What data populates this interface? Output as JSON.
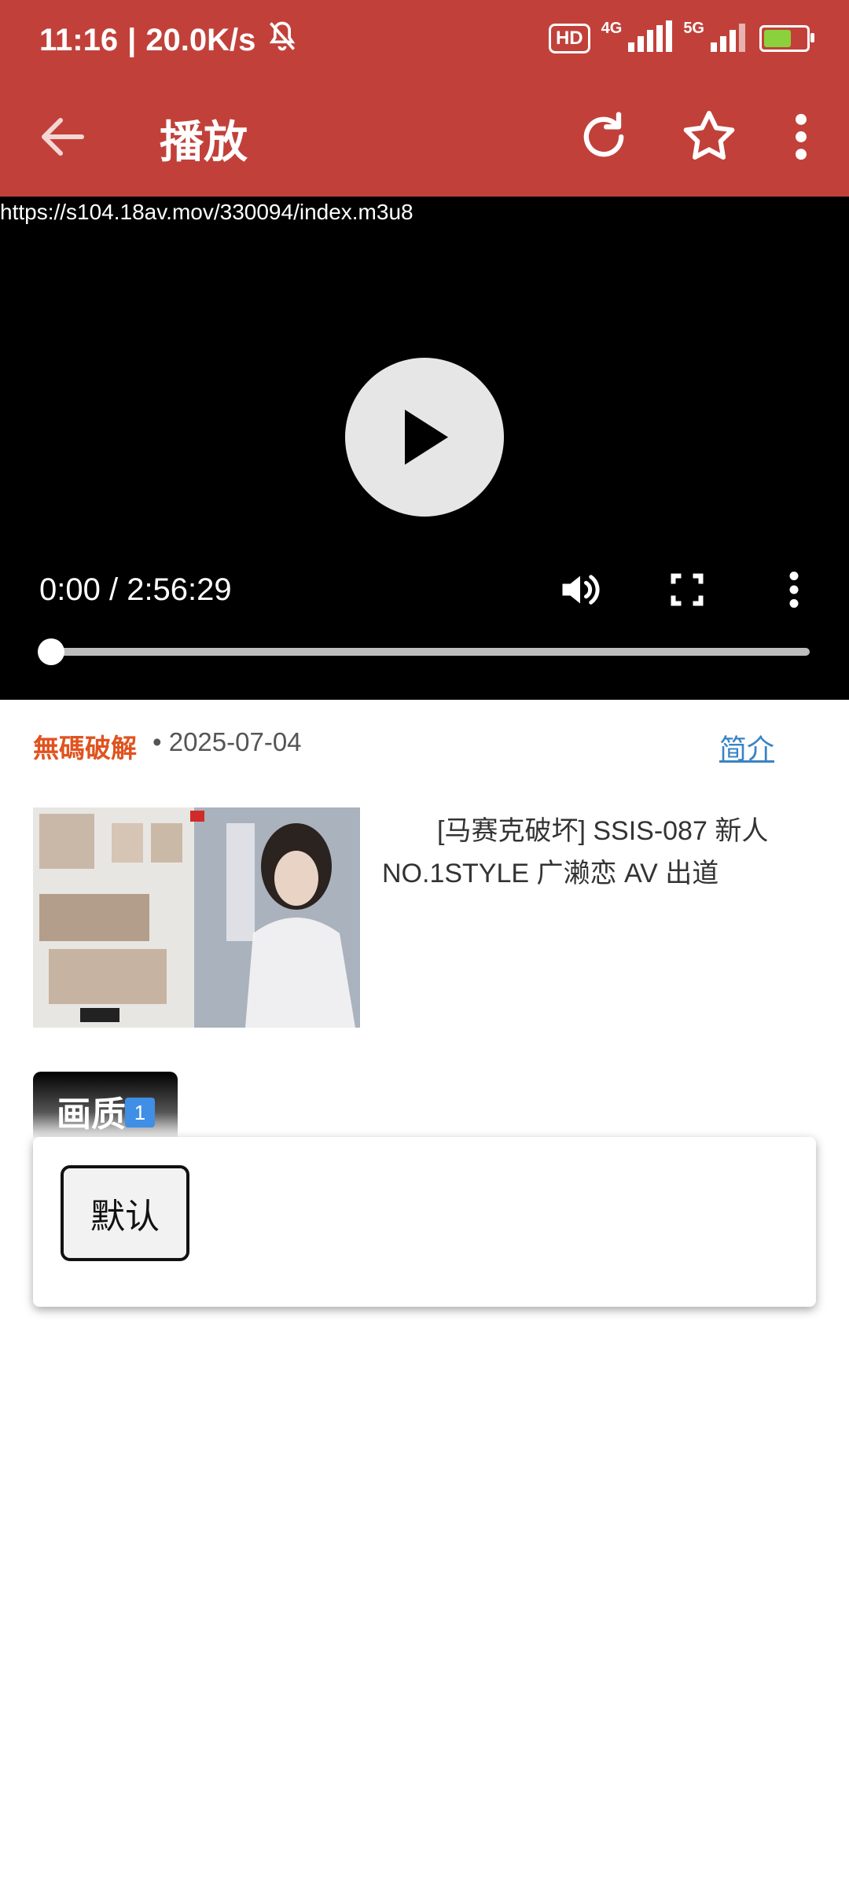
{
  "status_bar": {
    "time": "11:16",
    "separator": "|",
    "network_speed": "20.0K/s",
    "hd_badge": "HD",
    "net_4g": "4G",
    "net_5g": "5G",
    "icons": [
      "mute-bell-icon",
      "signal-icon",
      "battery-charging-icon"
    ],
    "battery_color": "#8bd13b"
  },
  "app_bar": {
    "title": "播放",
    "color": "#c1413a",
    "icons": [
      "back-arrow-icon",
      "refresh-icon",
      "star-icon",
      "more-vert-icon"
    ]
  },
  "player": {
    "url": "https://s104.18av.mov/330094/index.m3u8",
    "time_display": "0:00 / 2:56:29",
    "progress": 0.0,
    "icons": [
      "play-icon",
      "volume-icon",
      "fullscreen-icon",
      "more-vert-icon"
    ]
  },
  "info": {
    "tag": "無碼破解",
    "date": "• 2025-07-04",
    "intro_link": "简介",
    "tag_color": "#e0531f",
    "link_color": "#3a83c4"
  },
  "video": {
    "title": "[马赛克破坏] SSIS-087 新人NO.1STYLE 广濑恋 AV 出道"
  },
  "quality": {
    "tab_label": "画质",
    "count": "1",
    "options": [
      "默认"
    ]
  }
}
